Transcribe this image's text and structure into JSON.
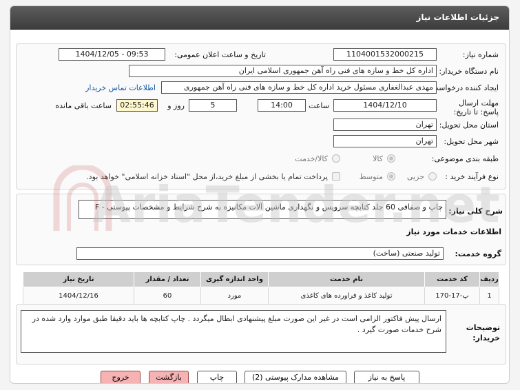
{
  "header": {
    "title": "جزئیات اطلاعات نیاز"
  },
  "info": {
    "need_number_label": "شماره نیاز:",
    "need_number": "1104001532000215",
    "announce_label": "تاریخ و ساعت اعلان عمومی:",
    "announce_value": "1404/12/05 - 09:53",
    "buyer_org_label": "نام دستگاه خریدار:",
    "buyer_org": "اداره کل خط و سازه های فنی راه آهن جمهوری اسلامی ایران",
    "creator_label": "ایجاد کننده درخواست:",
    "creator": "مهدی عبدالغفاری مسئول خرید اداره کل خط و سازه های فنی راه آهن جمهوری",
    "contact_link": "اطلاعات تماس خریدار",
    "deadline_label": "مهلت ارسال پاسخ: تا تاریخ:",
    "deadline_date": "1404/12/10",
    "time_label": "ساعت",
    "deadline_time": "14:00",
    "days_value": "5",
    "days_label": "روز و",
    "remaining_time": "02:55:46",
    "remaining_label": "ساعت باقی مانده",
    "province_label": "استان محل تحویل:",
    "province": "تهران",
    "city_label": "شهر محل تحویل:",
    "city": "تهران",
    "category_label": "طبقه بندی موضوعی:",
    "category_options": [
      "کالا",
      "کالا/خدمت"
    ],
    "process_label": "نوع فرآیند خرید :",
    "process_options": [
      "جزیی",
      "متوسط"
    ],
    "payment_note": "پرداخت تمام یا بخشی از مبلغ خرید،از محل \"اسناد خزانه اسلامی\" خواهد بود."
  },
  "summary": {
    "label": "شرح کلی نیاز:",
    "text": "چاپ و صفافی 60 جلد کتابچه سرویس و نگهداری ماشین آلات مکانیزه به شرح شرایط و مشخصات پیوستی - F"
  },
  "services": {
    "section_title": "اطلاعات خدمات مورد نیاز",
    "group_label": "گروه خدمت:",
    "group_value": "تولید صنعتی (ساخت)",
    "columns": [
      "ردیف",
      "کد خدمت",
      "نام خدمت",
      "واحد اندازه گیری",
      "تعداد / مقدار",
      "تاریخ نیاز"
    ],
    "rows": [
      {
        "row": "1",
        "code": "پ-17-170",
        "name": "تولید کاغذ و فراورده های کاغذی",
        "unit": "مورد",
        "qty": "60",
        "date": "1404/12/16"
      }
    ]
  },
  "buyer_notes": {
    "label": "توضیحات خریدار:",
    "text": "ارسال پیش فاکتور الزامی است در غیر این صورت مبلغ پیشنهادی ابطال میگردد . چاپ کتابچه ها باید دقیقا طبق موارد وارد شده در شرح خدمات صورت گیرد ."
  },
  "buttons": {
    "reply": "پاسخ به نیاز",
    "attachments": "مشاهده مدارک پیوستی (2)",
    "print": "چاپ",
    "back": "بازگشت",
    "exit": "خروج"
  },
  "colors": {
    "header": "#4a4a4a",
    "red_button": "#f6b3b3",
    "timer": "#fff8cc",
    "link": "#1457a8"
  }
}
